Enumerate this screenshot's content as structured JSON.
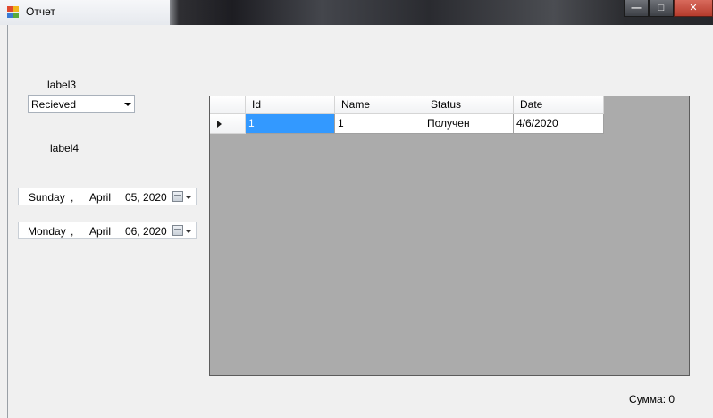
{
  "window": {
    "title": "Отчет",
    "controls": [
      "minimize",
      "maximize",
      "close"
    ]
  },
  "form": {
    "label3": "label3",
    "label4": "label4",
    "status_combo": {
      "value": "Recieved"
    },
    "date_from": {
      "day": "Sunday",
      "sep": ",",
      "month": "April",
      "date": "05, 2020"
    },
    "date_to": {
      "day": "Monday",
      "sep": ",",
      "month": "April",
      "date": "06, 2020"
    },
    "sum_label": "Сумма: 0"
  },
  "grid": {
    "columns": [
      "Id",
      "Name",
      "Status",
      "Date"
    ],
    "rows": [
      {
        "id": "1",
        "name": "1",
        "status": "Получен",
        "date": "4/6/2020"
      }
    ]
  },
  "colors": {
    "grid_background": "#ababab",
    "selection": "#3399ff",
    "form_background": "#f0f0f0"
  }
}
